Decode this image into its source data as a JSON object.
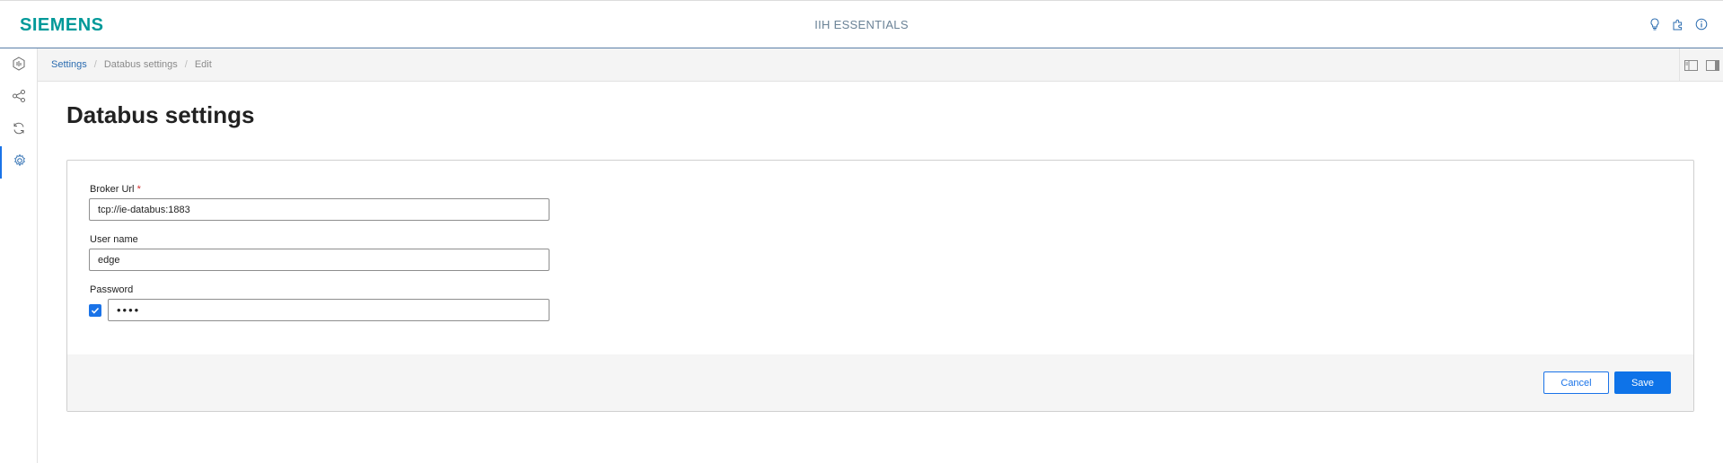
{
  "header": {
    "logo": "SIEMENS",
    "app_title": "IIH ESSENTIALS",
    "icons": [
      "lightbulb-icon",
      "puzzle-icon",
      "info-icon"
    ]
  },
  "sidebar": {
    "items": [
      {
        "icon": "hexagon-chart-icon",
        "active": false
      },
      {
        "icon": "share-nodes-icon",
        "active": false
      },
      {
        "icon": "sync-icon",
        "active": false
      },
      {
        "icon": "gear-icon",
        "active": true
      }
    ]
  },
  "breadcrumb": {
    "items": [
      "Settings",
      "Databus settings",
      "Edit"
    ],
    "separator": "/"
  },
  "page": {
    "title": "Databus settings"
  },
  "form": {
    "broker_url": {
      "label": "Broker Url",
      "required_mark": "*",
      "value": "tcp://ie-databus:1883"
    },
    "user_name": {
      "label": "User name",
      "value": "edge"
    },
    "password": {
      "label": "Password",
      "value": "••••",
      "checkbox_checked": true
    }
  },
  "actions": {
    "cancel_label": "Cancel",
    "save_label": "Save"
  },
  "colors": {
    "brand": "#009999",
    "primary": "#1a73e8",
    "required": "#d32f2f"
  }
}
